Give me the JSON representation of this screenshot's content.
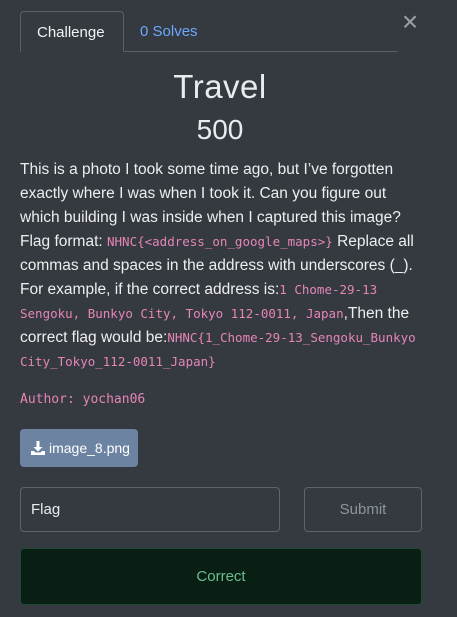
{
  "tabs": {
    "challenge_label": "Challenge",
    "solves_label": "0 Solves"
  },
  "close_icon": "close-icon",
  "challenge": {
    "title": "Travel",
    "points": "500",
    "description_intro": "This is a photo I took some time ago, but I’ve forgotten exactly where I was when I took it. Can you figure out which building I was inside when I captured this image? Flag format: ",
    "flag_format": "NHNC{<address_on_google_maps>}",
    "description_mid": " Replace all commas and spaces in the address with underscores (_). For example, if the correct address is:",
    "example_address": "1 Chome-29-13 Sengoku, Bunkyo City, Tokyo 112-0011, Japan",
    "description_then": ",Then the correct flag would be:",
    "example_flag": "NHNC{1_Chome-29-13_Sengoku_Bunkyo City_Tokyo_112-0011_Japan}",
    "author": "Author: yochan06",
    "file_label": "image_8.png",
    "file_icon": "download-icon"
  },
  "form": {
    "flag_placeholder": "Flag",
    "submit_label": "Submit",
    "result_text": "Correct"
  },
  "colors": {
    "background": "#343a40",
    "link": "#6ea8fe",
    "code": "#e685b5",
    "file_button": "#6c83a2",
    "success_bg": "#0a1f14",
    "success_text": "#6bbd8e"
  }
}
